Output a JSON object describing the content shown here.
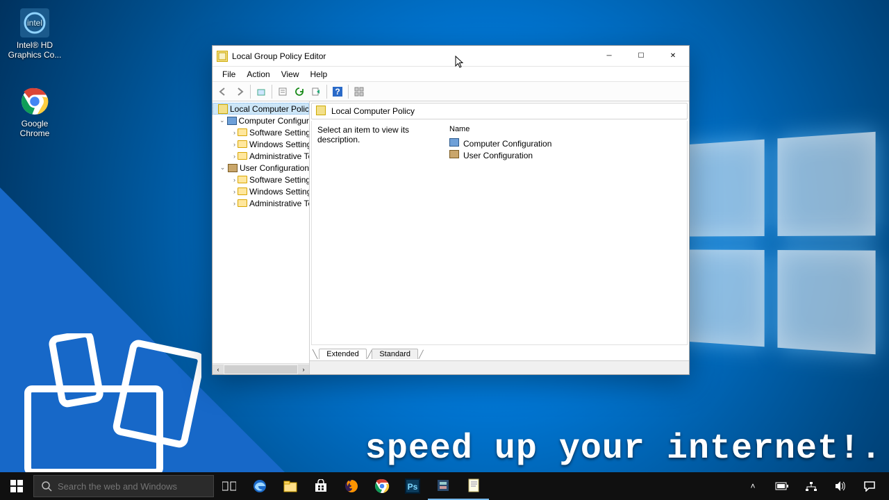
{
  "desktop": {
    "icons": [
      {
        "label": "Intel® HD Graphics Co...",
        "name": "desktop-icon-intel"
      },
      {
        "label": "Google Chrome",
        "name": "desktop-icon-chrome"
      }
    ],
    "caption": "speed up your internet!."
  },
  "window": {
    "title": "Local Group Policy Editor",
    "menu": [
      "File",
      "Action",
      "View",
      "Help"
    ],
    "toolbar_icons": [
      "back",
      "forward",
      "sep",
      "up",
      "sep",
      "props",
      "refresh",
      "export",
      "sep",
      "help",
      "sep",
      "tile"
    ],
    "tree": {
      "root": "Local Computer Policy",
      "nodes": [
        {
          "label": "Computer Configuration",
          "expanded": true,
          "icon": "comp",
          "children": [
            {
              "label": "Software Settings",
              "icon": "folder"
            },
            {
              "label": "Windows Settings",
              "icon": "folder"
            },
            {
              "label": "Administrative Templates",
              "icon": "folder"
            }
          ]
        },
        {
          "label": "User Configuration",
          "expanded": true,
          "icon": "comp",
          "children": [
            {
              "label": "Software Settings",
              "icon": "folder"
            },
            {
              "label": "Windows Settings",
              "icon": "folder"
            },
            {
              "label": "Administrative Templates",
              "icon": "folder"
            }
          ]
        }
      ]
    },
    "pane": {
      "title": "Local Computer Policy",
      "description": "Select an item to view its description.",
      "column_header": "Name",
      "items": [
        {
          "label": "Computer Configuration"
        },
        {
          "label": "User Configuration"
        }
      ],
      "tabs": [
        "Extended",
        "Standard"
      ]
    }
  },
  "taskbar": {
    "search_placeholder": "Search the web and Windows",
    "tray_chevron": "˄"
  }
}
